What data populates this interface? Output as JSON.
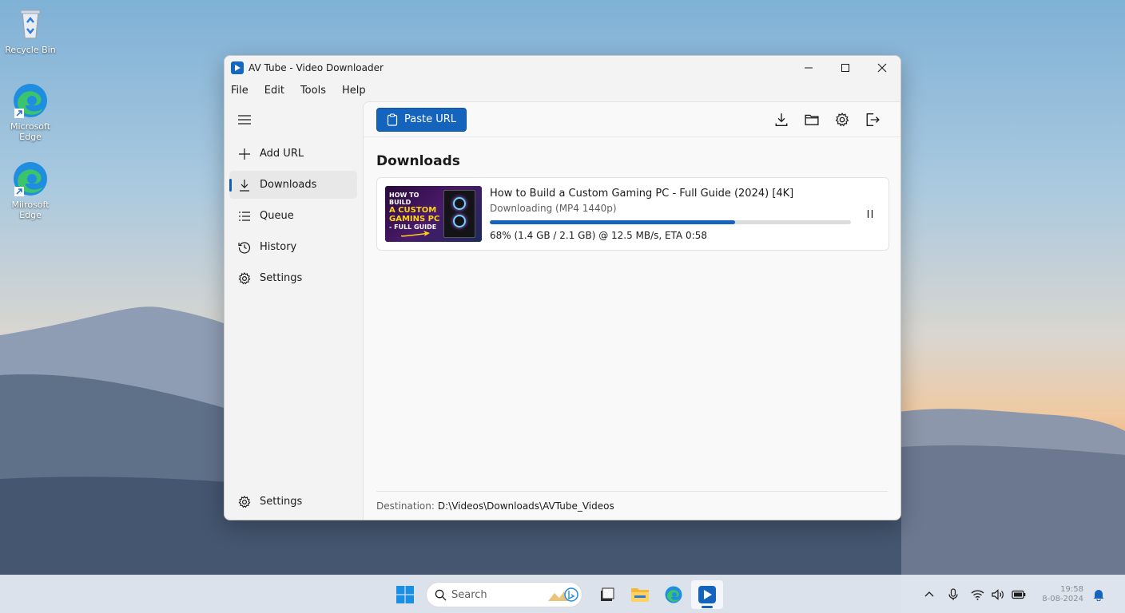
{
  "desktop": {
    "icons": [
      {
        "label": "Recycle Bin"
      },
      {
        "label": "Microsoft Edge"
      },
      {
        "label": "Miirosoft Edge"
      }
    ]
  },
  "window": {
    "title": "AV Tube - Video Downloader",
    "menu": [
      "File",
      "Edit",
      "Tools",
      "Help"
    ]
  },
  "sidebar": {
    "items": [
      {
        "label": "Add URL",
        "icon": "plus-icon"
      },
      {
        "label": "Downloads",
        "icon": "download-icon",
        "active": true
      },
      {
        "label": "Queue",
        "icon": "list-icon"
      },
      {
        "label": "History",
        "icon": "history-icon"
      },
      {
        "label": "Settings",
        "icon": "gear-icon"
      }
    ],
    "bottom": {
      "label": "Settings",
      "icon": "gear-icon"
    }
  },
  "toolbar": {
    "paste_label": "Paste URL"
  },
  "main": {
    "section_title": "Downloads",
    "download": {
      "title": "How to Build a Custom Gaming PC - Full Guide (2024) [4K]",
      "status": "Downloading (MP4 1440p)",
      "progress_percent": 68,
      "detail": "68% (1.4 GB / 2.1 GB) @ 12.5 MB/s, ETA 0:58",
      "thumbnail_text": {
        "line1": "HOW TO BUILD",
        "line2": "A CUSTOM",
        "line3": "GAMINS PC",
        "line4": "- FULL GUIDE"
      }
    },
    "footer": {
      "label": "Destination:",
      "path": "D:\\Videos\\Downloads\\AVTube_Videos"
    }
  },
  "taskbar": {
    "search_label": "Search",
    "clock_time": "19:58",
    "clock_date": "8-08-2024"
  },
  "colors": {
    "accent": "#1464bd"
  }
}
